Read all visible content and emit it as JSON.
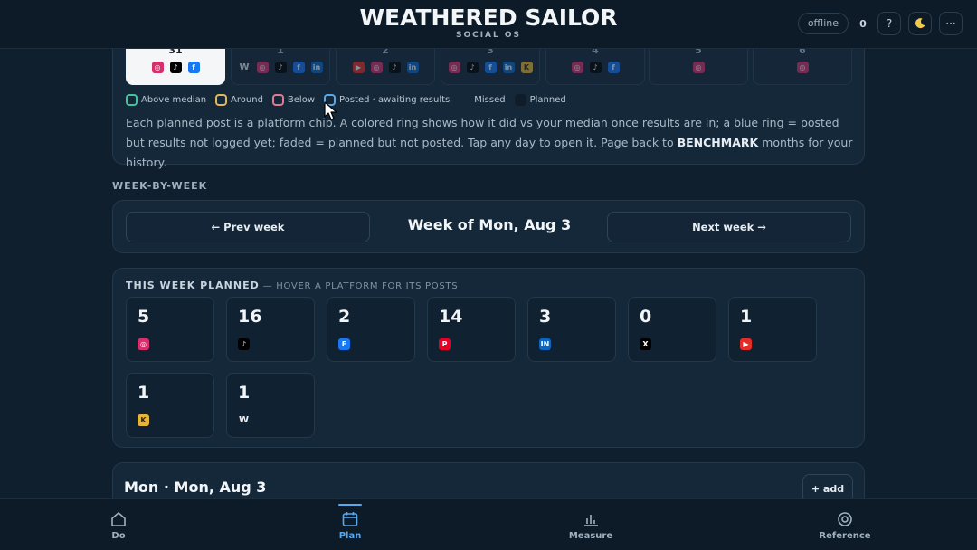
{
  "app": {
    "title": "WEATHERED SAILOR",
    "subtitle": "SOCIAL OS"
  },
  "header": {
    "status": "offline",
    "count": "0",
    "help_label": "?",
    "theme_icon": "moon-icon",
    "more_label": "···"
  },
  "calendar": {
    "days": [
      {
        "num": "31",
        "today": true,
        "icons": [
          {
            "p": "ig",
            "t": "◎"
          },
          {
            "p": "tt",
            "t": "♪"
          },
          {
            "p": "fb",
            "t": "f"
          }
        ]
      },
      {
        "num": "1",
        "today": false,
        "icons": [
          {
            "p": "ww",
            "t": "W"
          },
          {
            "p": "ig",
            "t": "◎"
          },
          {
            "p": "tt",
            "t": "♪"
          },
          {
            "p": "fb",
            "t": "f"
          },
          {
            "p": "li",
            "t": "in"
          }
        ]
      },
      {
        "num": "2",
        "today": false,
        "icons": [
          {
            "p": "yt",
            "t": "▶"
          },
          {
            "p": "ig",
            "t": "◎"
          },
          {
            "p": "tt",
            "t": "♪"
          },
          {
            "p": "li",
            "t": "in"
          }
        ]
      },
      {
        "num": "3",
        "today": false,
        "icons": [
          {
            "p": "ig",
            "t": "◎"
          },
          {
            "p": "tt",
            "t": "♪"
          },
          {
            "p": "fb",
            "t": "f"
          },
          {
            "p": "li",
            "t": "in"
          },
          {
            "p": "kf",
            "t": "K"
          }
        ]
      },
      {
        "num": "4",
        "today": false,
        "icons": [
          {
            "p": "ig",
            "t": "◎"
          },
          {
            "p": "tt",
            "t": "♪"
          },
          {
            "p": "fb",
            "t": "f"
          }
        ]
      },
      {
        "num": "5",
        "today": false,
        "icons": [
          {
            "p": "ig",
            "t": "◎"
          }
        ]
      },
      {
        "num": "6",
        "today": false,
        "icons": [
          {
            "p": "ig",
            "t": "◎"
          }
        ]
      }
    ],
    "legend": {
      "above": "Above median",
      "around": "Around",
      "below": "Below",
      "posted": "Posted · awaiting results",
      "missed": "Missed",
      "planned": "Planned"
    },
    "explain_pre": "Each planned post is a platform chip. A colored ring shows how it did vs your median once results are in; a blue ring = posted but results not logged yet; faded = planned but not posted. Tap any day to open it. Page back to ",
    "explain_bold": "BENCHMARK",
    "explain_post": " months for your history."
  },
  "week": {
    "section_label": "WEEK-BY-WEEK",
    "prev_label": "← Prev week",
    "title": "Week of Mon, Aug 3",
    "next_label": "Next week →"
  },
  "plan": {
    "heading": "THIS WEEK PLANNED",
    "hint": "— HOVER A PLATFORM FOR ITS POSTS",
    "tiles": [
      {
        "count": "5",
        "platform": "instagram",
        "p": "ig",
        "t": "◎"
      },
      {
        "count": "16",
        "platform": "tiktok",
        "p": "tt",
        "t": "♪"
      },
      {
        "count": "2",
        "platform": "facebook",
        "p": "fb",
        "t": "F"
      },
      {
        "count": "14",
        "platform": "pinterest",
        "p": "pn",
        "t": "P"
      },
      {
        "count": "3",
        "platform": "linkedin",
        "p": "li",
        "t": "IN"
      },
      {
        "count": "0",
        "platform": "x",
        "p": "xx",
        "t": "X"
      },
      {
        "count": "1",
        "platform": "youtube",
        "p": "yt",
        "t": "▶"
      },
      {
        "count": "1",
        "platform": "kofi",
        "p": "kf",
        "t": "K"
      },
      {
        "count": "1",
        "platform": "website",
        "p": "ww",
        "t": "W"
      }
    ]
  },
  "day": {
    "title": "Mon · Mon, Aug 3",
    "add_label": "+ add"
  },
  "nav": {
    "items": [
      {
        "label": "Do",
        "icon": "home-icon"
      },
      {
        "label": "Plan",
        "icon": "calendar-icon"
      },
      {
        "label": "Measure",
        "icon": "bar-chart-icon"
      },
      {
        "label": "Reference",
        "icon": "target-icon"
      }
    ],
    "active": "Plan"
  }
}
